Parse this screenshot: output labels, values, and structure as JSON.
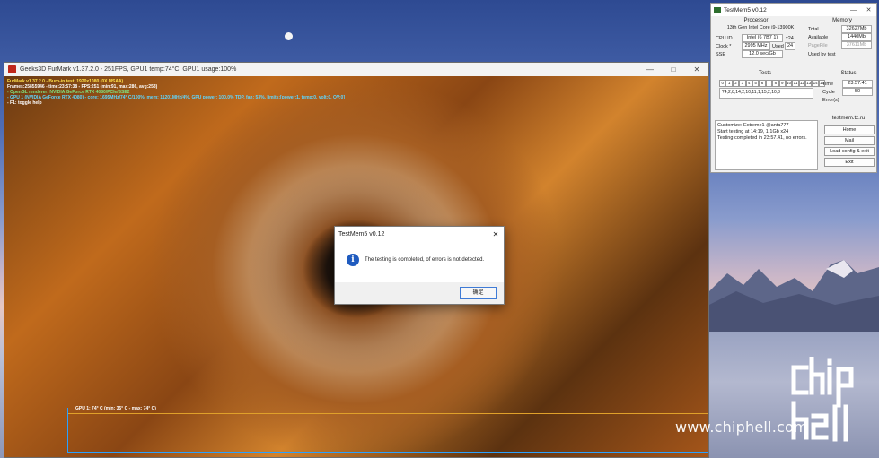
{
  "furmark": {
    "title": "Geeks3D FurMark v1.37.2.0 - 251FPS, GPU1 temp:74°C, GPU1 usage:100%",
    "hud": {
      "line1": "FurMark v1.37.2.0 - Burn-in test, 1920x1080 (0X MSAA)",
      "line2": "Frames:25855946 - time:23:57:38 - FPS:251 (min:91, max:286, avg:253)",
      "line3": "- OpenGL renderer: NVIDIA GeForce RTX 4080/PCIe/SSE2",
      "line4": "- GPU 1 (NVIDIA GeForce RTX 4080) - core: 1695MHz/74° C/100%, mem: 11201MHz/4%, GPU power: 100.0% TDP, fan: 53%, limits:[power:1, temp:0, volt:0, OV:0]",
      "line5": "- F1: toggle help"
    },
    "graph_label": "GPU 1: 74° C (min: 35° C - max: 74° C)"
  },
  "testmem": {
    "title": "TestMem5 v0.12",
    "processor": {
      "heading": "Processor",
      "name": "13th Gen Intel Core i9-13900K",
      "cpu_id_label": "CPU ID",
      "cpu_id_value": "Intel (6 7B7 1)",
      "cpu_threads": "x24",
      "clock_label": "Clock *",
      "clock_value": "2995 MHz",
      "used_label": "Used",
      "used_value": "24",
      "sse_label": "SSE",
      "sse_value": "12.0 sec/Gb"
    },
    "memory": {
      "heading": "Memory",
      "total_label": "Total",
      "total_value": "32627Mb",
      "available_label": "Available",
      "available_value": "1440Mb",
      "pagefile_label": "PageFile",
      "pagefile_value": "37611Mb",
      "usedbytest_label": "Used by test",
      "usedbytest_value": ""
    },
    "tests": {
      "heading": "Tests",
      "cells": [
        "0",
        "1",
        "2",
        "3",
        "4",
        "5",
        "6",
        "7",
        "8",
        "9",
        "10",
        "11",
        "12",
        "13",
        "14",
        "15"
      ],
      "sequence": "?4,2,8,14,2,10,11,1,15,2,10,3"
    },
    "status": {
      "heading": "Status",
      "time_label": "Time",
      "time_value": "23:57.41",
      "cycle_label": "Cycle",
      "cycle_value": "50",
      "errors_label": "Error(s)",
      "errors_value": ""
    },
    "log": {
      "line1": "Customize: Extreme1 @anta777",
      "line2": "Start testing at 14:19, 1.1Gb x24",
      "line3": "Testing completed in 23:57.41, no errors."
    },
    "site": {
      "heading": "testmem.tz.ru",
      "home": "Home",
      "mail": "Mail",
      "load": "Load config & exit",
      "exit": "Exit"
    }
  },
  "dialog": {
    "title": "TestMem5 v0.12",
    "message": "The testing is completed, of errors is not detected.",
    "ok_label": "确定"
  },
  "watermark": {
    "url": "www.chiphell.com"
  },
  "colors": {
    "hud_yellow": "#ffe04a",
    "hud_cyan": "#5fd6ff",
    "graph_axis": "#2aa1ff",
    "graph_line": "#e0a12a",
    "info_blue": "#1f5bbf"
  }
}
